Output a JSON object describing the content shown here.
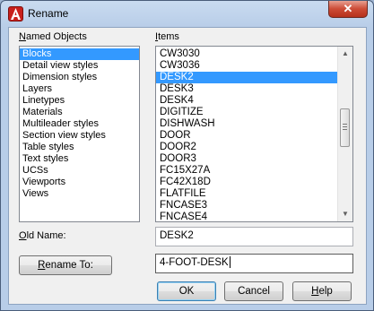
{
  "window": {
    "title": "Rename",
    "close_glyph": "✕"
  },
  "named_objects": {
    "label_underlined": "N",
    "label_rest": "amed Objects",
    "items": [
      {
        "label": "Blocks",
        "selected": true
      },
      {
        "label": "Detail view styles",
        "selected": false
      },
      {
        "label": "Dimension styles",
        "selected": false
      },
      {
        "label": "Layers",
        "selected": false
      },
      {
        "label": "Linetypes",
        "selected": false
      },
      {
        "label": "Materials",
        "selected": false
      },
      {
        "label": "Multileader styles",
        "selected": false
      },
      {
        "label": "Section view styles",
        "selected": false
      },
      {
        "label": "Table styles",
        "selected": false
      },
      {
        "label": "Text styles",
        "selected": false
      },
      {
        "label": "UCSs",
        "selected": false
      },
      {
        "label": "Viewports",
        "selected": false
      },
      {
        "label": "Views",
        "selected": false
      }
    ]
  },
  "items_list": {
    "label_underlined": "I",
    "label_rest": "tems",
    "items": [
      {
        "label": "CW3030",
        "selected": false
      },
      {
        "label": "CW3036",
        "selected": false
      },
      {
        "label": "DESK2",
        "selected": true
      },
      {
        "label": "DESK3",
        "selected": false
      },
      {
        "label": "DESK4",
        "selected": false
      },
      {
        "label": "DIGITIZE",
        "selected": false
      },
      {
        "label": "DISHWASH",
        "selected": false
      },
      {
        "label": "DOOR",
        "selected": false
      },
      {
        "label": "DOOR2",
        "selected": false
      },
      {
        "label": "DOOR3",
        "selected": false
      },
      {
        "label": "FC15X27A",
        "selected": false
      },
      {
        "label": "FC42X18D",
        "selected": false
      },
      {
        "label": "FLATFILE",
        "selected": false
      },
      {
        "label": "FNCASE3",
        "selected": false
      },
      {
        "label": "FNCASE4",
        "selected": false
      }
    ],
    "scroll_up_glyph": "▲",
    "scroll_down_glyph": "▼"
  },
  "old_name": {
    "label_underlined": "O",
    "label_rest": "ld Name:",
    "value": "DESK2"
  },
  "rename_to": {
    "button_underlined": "R",
    "button_rest": "ename To:",
    "value": "4-FOOT-DESK"
  },
  "buttons": {
    "ok": "OK",
    "cancel": "Cancel",
    "help_underlined": "H",
    "help_rest": "elp"
  },
  "icons": {
    "app": "autocad-logo-icon",
    "close": "close-icon",
    "scroll_up": "scroll-up-arrow-icon",
    "scroll_down": "scroll-down-arrow-icon"
  },
  "colors": {
    "selection": "#3399ff",
    "close_button": "#cc4b36",
    "app_icon": "#c8201c"
  }
}
